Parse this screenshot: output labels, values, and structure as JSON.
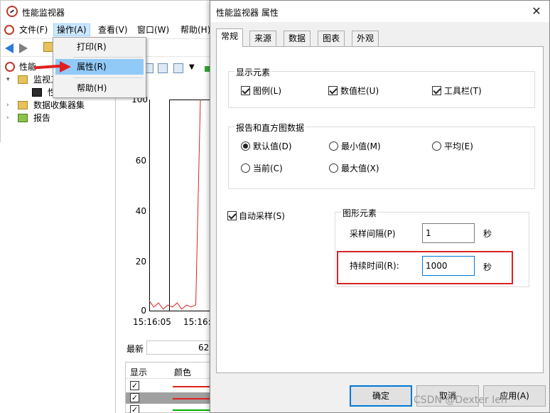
{
  "main_window": {
    "title": "性能监视器",
    "menu": [
      "文件(F)",
      "操作(A)",
      "查看(V)",
      "窗口(W)",
      "帮助(H)"
    ],
    "active_menu_index": 1,
    "tree": {
      "root": "性能",
      "monitor_tools": "监视工",
      "perf_monitor": "性",
      "data_collector_sets": "数据收集器集",
      "reports": "报告"
    }
  },
  "dropdown_menu": {
    "items": [
      "打印(R)",
      "属性(R)",
      "帮助(H)"
    ],
    "highlighted_index": 1
  },
  "chart": {
    "y_ticks": [
      "100",
      "60",
      "40",
      "20",
      "0"
    ],
    "x_ticks": [
      "15:16:05",
      "15:16:1"
    ],
    "stats_label": "最新",
    "stats_value": "62.",
    "legend_headers": [
      "显示",
      "颜色"
    ],
    "series_colors": [
      "#e02020",
      "#e02020",
      "#00b000"
    ]
  },
  "chart_data": {
    "type": "line",
    "ylim": [
      0,
      100
    ],
    "x_ticks": [
      "15:16:05",
      "15:16:1"
    ],
    "series": [
      {
        "values": [
          5,
          2,
          4,
          1,
          3,
          2,
          4,
          1,
          3,
          2,
          3,
          100
        ]
      }
    ]
  },
  "dialog": {
    "title": "性能监视器 属性",
    "close_glyph": "✕",
    "tabs": [
      "常规",
      "来源",
      "数据",
      "图表",
      "外观"
    ],
    "selected_tab_index": 0,
    "display_elements": {
      "title": "显示元素",
      "legend": "图例(L)",
      "value_bar": "数值栏(U)",
      "toolbar": "工具栏(T)"
    },
    "report_histogram": {
      "title": "报告和直方图数据",
      "default": "默认值(D)",
      "minimum": "最小值(M)",
      "average": "平均(E)",
      "current": "当前(C)",
      "maximum": "最大值(X)",
      "selected": "default"
    },
    "auto_sample": {
      "label": "自动采样(S)",
      "checked": true
    },
    "graph_elements": {
      "title": "图形元素",
      "sample_interval_label": "采样间隔(P)",
      "sample_interval_value": "1",
      "sample_interval_unit": "秒",
      "duration_label": "持续时间(R):",
      "duration_value": "1000",
      "duration_unit": "秒"
    },
    "buttons": {
      "ok": "确定",
      "cancel": "取消",
      "apply": "应用(A)"
    }
  },
  "watermark": "CSDN @Dexter Ien",
  "colors": {
    "highlight_box": "#d9232a",
    "menu_highlight": "#91c9f7",
    "arrow": "#e02020"
  }
}
